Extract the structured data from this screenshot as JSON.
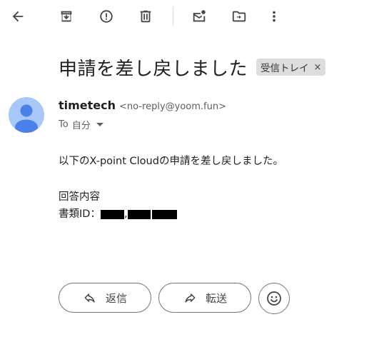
{
  "toolbar": {
    "icons": [
      "back-arrow-icon",
      "archive-icon",
      "report-spam-icon",
      "delete-icon",
      "mark-unread-icon",
      "move-to-icon",
      "more-vert-icon"
    ]
  },
  "email": {
    "subject": "申請を差し戻しました",
    "label": "受信トレイ",
    "label_remove": "×",
    "sender_name": "timetech",
    "sender_email": "<no-reply@yoom.fun>",
    "to_prefix": "To",
    "recipient": "自分",
    "body": {
      "line1": "以下のX-point Cloudの申請を差し戻しました。",
      "line2": "回答内容",
      "line3_label": "書類ID：",
      "line3_separator": ","
    }
  },
  "actions": {
    "reply_label": "返信",
    "forward_label": "転送"
  },
  "colors": {
    "avatar_bg": "#a8c7fa",
    "avatar_fg": "#4a80e8",
    "chip_bg": "#dddddd",
    "border": "#747775"
  }
}
